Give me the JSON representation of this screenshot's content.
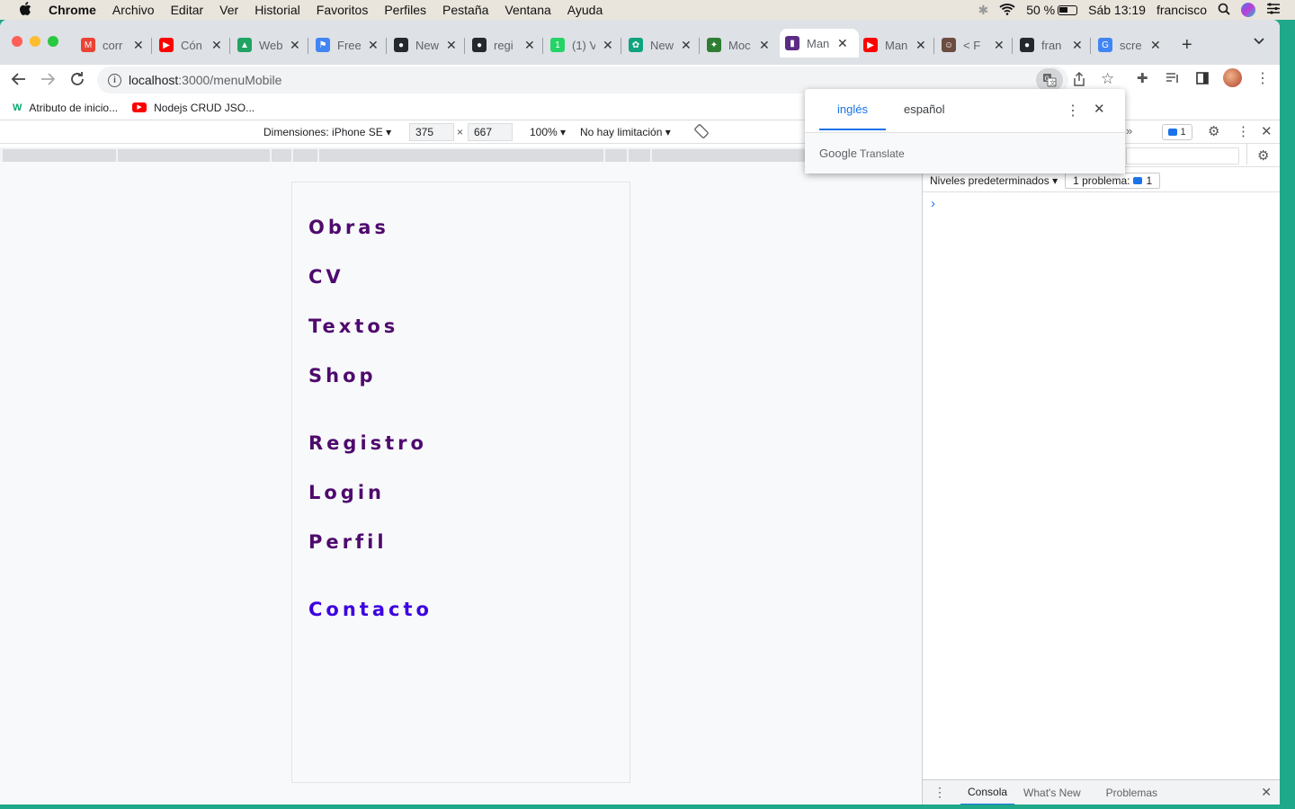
{
  "menubar": {
    "items": [
      "Chrome",
      "Archivo",
      "Editar",
      "Ver",
      "Historial",
      "Favoritos",
      "Perfiles",
      "Pestaña",
      "Ventana",
      "Ayuda"
    ],
    "battery": "50 %",
    "clock": "Sáb 13:19",
    "user": "francisco"
  },
  "tabs": [
    {
      "title": "corr",
      "icon": "gmail-icon",
      "color": "#ea4335",
      "glyph": "M"
    },
    {
      "title": "Cón",
      "icon": "youtube-icon",
      "color": "#ff0000",
      "glyph": "▶"
    },
    {
      "title": "Web",
      "icon": "drive-icon",
      "color": "#1fa463",
      "glyph": "▲"
    },
    {
      "title": "Free",
      "icon": "flag-icon",
      "color": "#4285f4",
      "glyph": "⚑"
    },
    {
      "title": "New",
      "icon": "github-icon",
      "color": "#24292e",
      "glyph": "●"
    },
    {
      "title": "regi",
      "icon": "github-icon",
      "color": "#24292e",
      "glyph": "●"
    },
    {
      "title": "(1) V",
      "icon": "whatsapp-icon",
      "color": "#25d366",
      "glyph": "1"
    },
    {
      "title": "New",
      "icon": "openai-icon",
      "color": "#10a37f",
      "glyph": "✿"
    },
    {
      "title": "Moc",
      "icon": "mockup-icon",
      "color": "#2e7d32",
      "glyph": "✦"
    },
    {
      "title": "Man",
      "icon": "site-icon",
      "color": "#5b2c83",
      "glyph": "▮"
    },
    {
      "title": "Man",
      "icon": "youtube-icon",
      "color": "#ff0000",
      "glyph": "▶"
    },
    {
      "title": "< F",
      "icon": "avatar-icon",
      "color": "#6d4c41",
      "glyph": "☺"
    },
    {
      "title": "fran",
      "icon": "github-icon",
      "color": "#24292e",
      "glyph": "●"
    },
    {
      "title": "scre",
      "icon": "google-icon",
      "color": "#4285f4",
      "glyph": "G"
    }
  ],
  "omnibox": {
    "host": "localhost",
    "path": ":3000/menuMobile"
  },
  "bookmarks": [
    {
      "label": "Atributo de inicio...",
      "icon": "w3-icon"
    },
    {
      "label": "Nodejs CRUD JSO...",
      "icon": "youtube-icon"
    }
  ],
  "device_toolbar": {
    "device": "Dimensiones: iPhone SE",
    "width": "375",
    "height": "667",
    "zoom": "100%",
    "throttle": "No hay limitación"
  },
  "menu": {
    "links": [
      "Obras",
      "CV",
      "Textos",
      "Shop",
      "Registro",
      "Login",
      "Perfil",
      "Contacto"
    ]
  },
  "devtools": {
    "issues_badge": "1",
    "levels": "Niveles predeterminados",
    "problems": "1 problema:",
    "problems_count": "1",
    "prompt": "›",
    "drawer_tabs": [
      "Consola",
      "What's New",
      "Problemas"
    ]
  },
  "translate": {
    "tab_en": "inglés",
    "tab_es": "español",
    "brand": "Google",
    "brand_suffix": "Translate"
  },
  "colors": {
    "menu_link": "#4f0a6e",
    "contact_link": "#3d00e0",
    "active_tab": "#1a73e8"
  }
}
